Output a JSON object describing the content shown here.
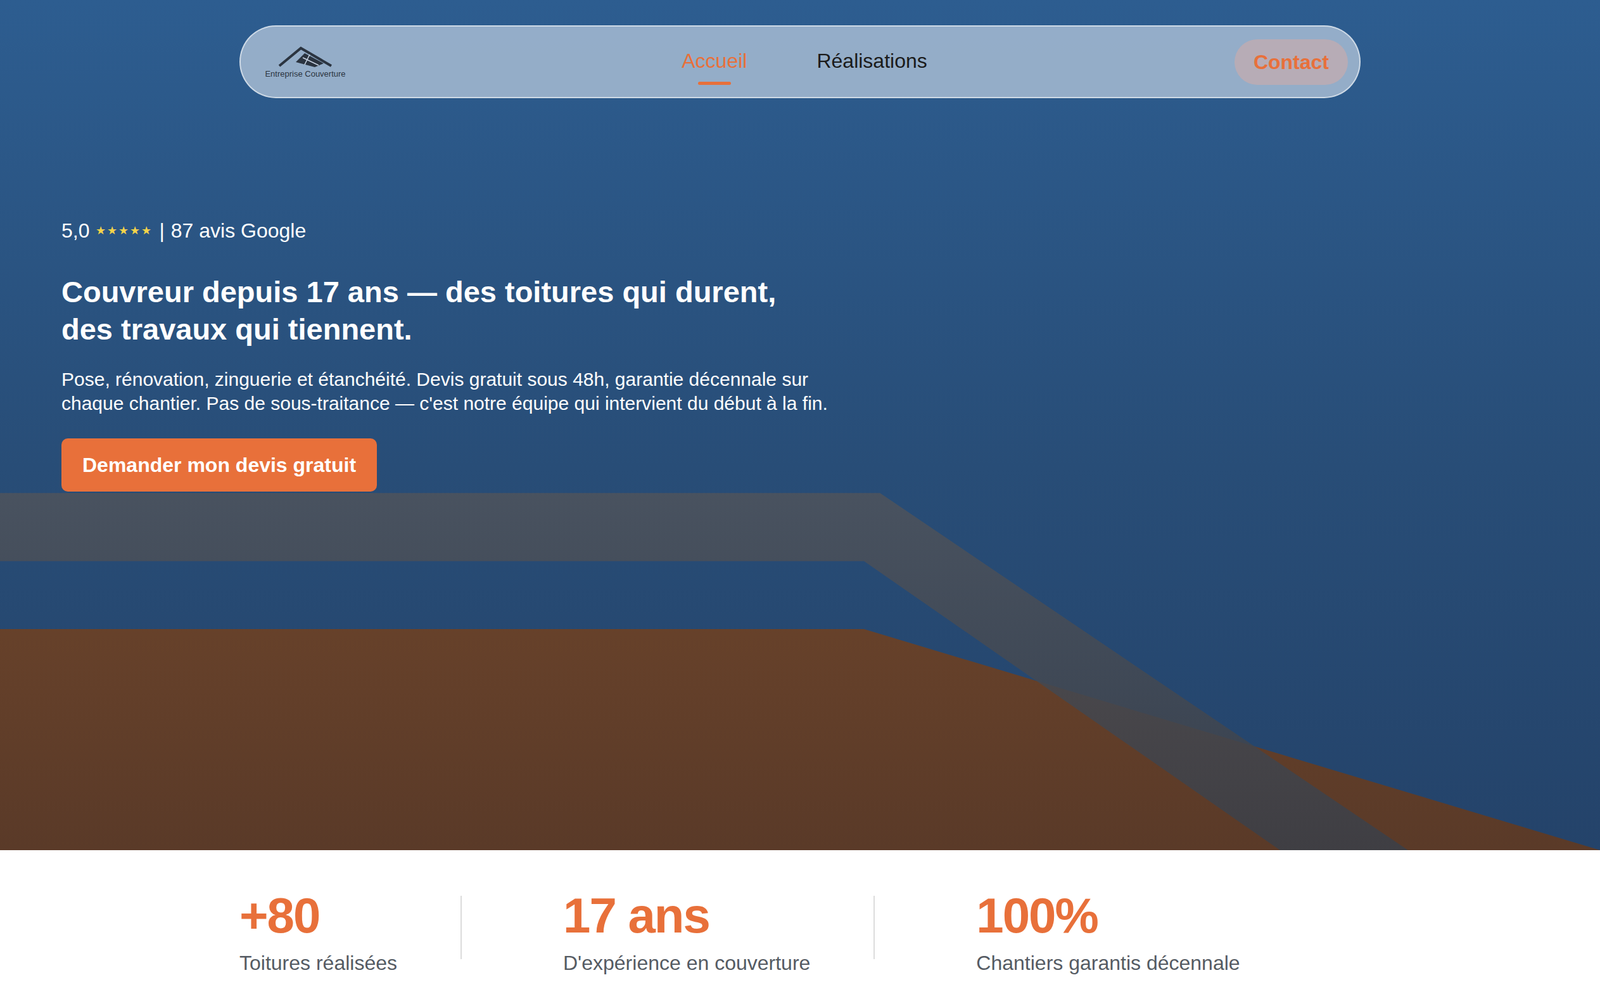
{
  "nav": {
    "logo_text": "Entreprise Couverture",
    "links": [
      {
        "label": "Accueil",
        "selected": true
      },
      {
        "label": "Réalisations",
        "selected": false
      }
    ],
    "contact": "Contact"
  },
  "hero": {
    "rating": "5,0",
    "star": "★",
    "stars": 5,
    "separator": "|",
    "reviews": "87 avis Google",
    "headline": [
      "Couvreur depuis 17 ans — des toitures qui durent,",
      "des travaux qui tiennent."
    ],
    "text": "Pose, rénovation, zinguerie et étanchéité. Devis gratuit sous 48h, garantie décennale sur chaque chantier. Pas de sous-traitance — c'est notre équipe qui intervient du début à la fin.",
    "cta": "Demander mon devis gratuit"
  },
  "stats": [
    {
      "value": "+80",
      "label": "Toitures réalisées"
    },
    {
      "value": "17 ans",
      "label": "D'expérience en couverture"
    },
    {
      "value": "100%",
      "label": "Chantiers garantis décennale"
    }
  ]
}
